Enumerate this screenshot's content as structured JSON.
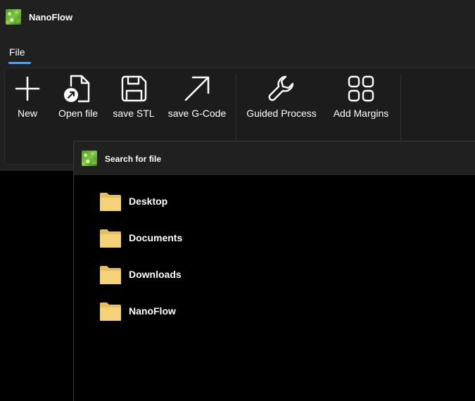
{
  "app": {
    "title": "NanoFlow",
    "logo_icon": "nanoflow-logo-icon"
  },
  "menu": {
    "tabs": [
      {
        "label": "File",
        "selected": true
      }
    ],
    "accent_color": "#4ba3ff"
  },
  "ribbon": {
    "buttons": [
      {
        "label": "New",
        "icon": "plus-icon"
      },
      {
        "label": "Open file",
        "icon": "open-file-icon"
      },
      {
        "label": "save STL",
        "icon": "floppy-disk-icon"
      },
      {
        "label": "save G-Code",
        "icon": "arrow-up-right-icon"
      },
      {
        "label": "Guided Process",
        "icon": "wrench-icon"
      },
      {
        "label": "Add Margins",
        "icon": "grid-squares-icon"
      }
    ]
  },
  "dialog": {
    "title": "Search for file",
    "folders": [
      {
        "label": "Desktop",
        "icon": "folder-icon"
      },
      {
        "label": "Documents",
        "icon": "folder-icon"
      },
      {
        "label": "Downloads",
        "icon": "folder-icon"
      },
      {
        "label": "NanoFlow",
        "icon": "folder-icon"
      }
    ],
    "folder_color": "#f5d27a"
  }
}
